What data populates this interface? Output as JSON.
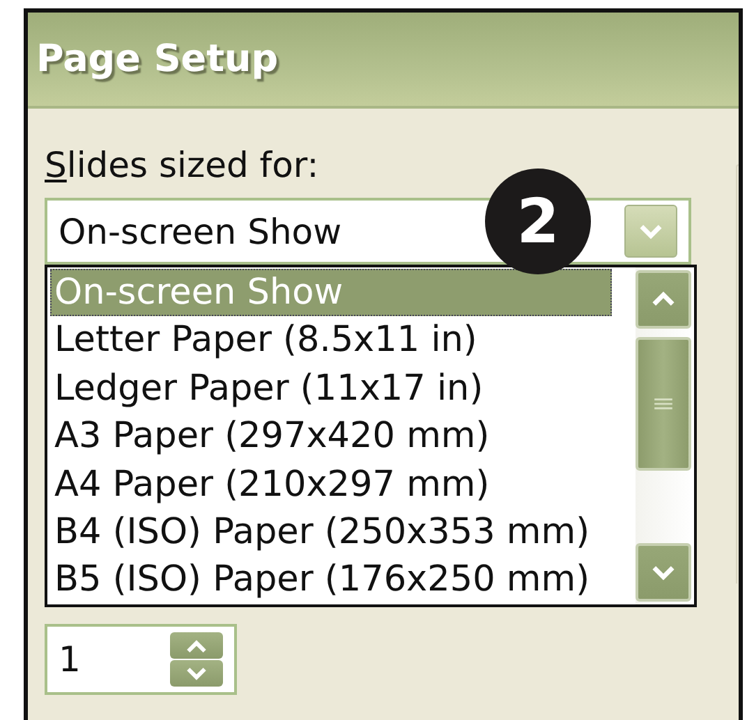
{
  "window": {
    "title": "Page Setup"
  },
  "slides_sized_for": {
    "label_access_key": "S",
    "label_rest": "lides sized for:",
    "value": "On-screen Show",
    "expanded": true,
    "options": [
      {
        "label": "On-screen Show",
        "selected": true
      },
      {
        "label": "Letter Paper (8.5x11 in)",
        "selected": false
      },
      {
        "label": "Ledger Paper (11x17 in)",
        "selected": false
      },
      {
        "label": "A3 Paper (297x420 mm)",
        "selected": false
      },
      {
        "label": "A4 Paper (210x297 mm)",
        "selected": false
      },
      {
        "label": "B4 (ISO) Paper (250x353 mm)",
        "selected": false
      },
      {
        "label": "B5 (ISO) Paper (176x250 mm)",
        "selected": false
      }
    ]
  },
  "spin_field": {
    "value": "1"
  },
  "callout": {
    "number": "2"
  }
}
